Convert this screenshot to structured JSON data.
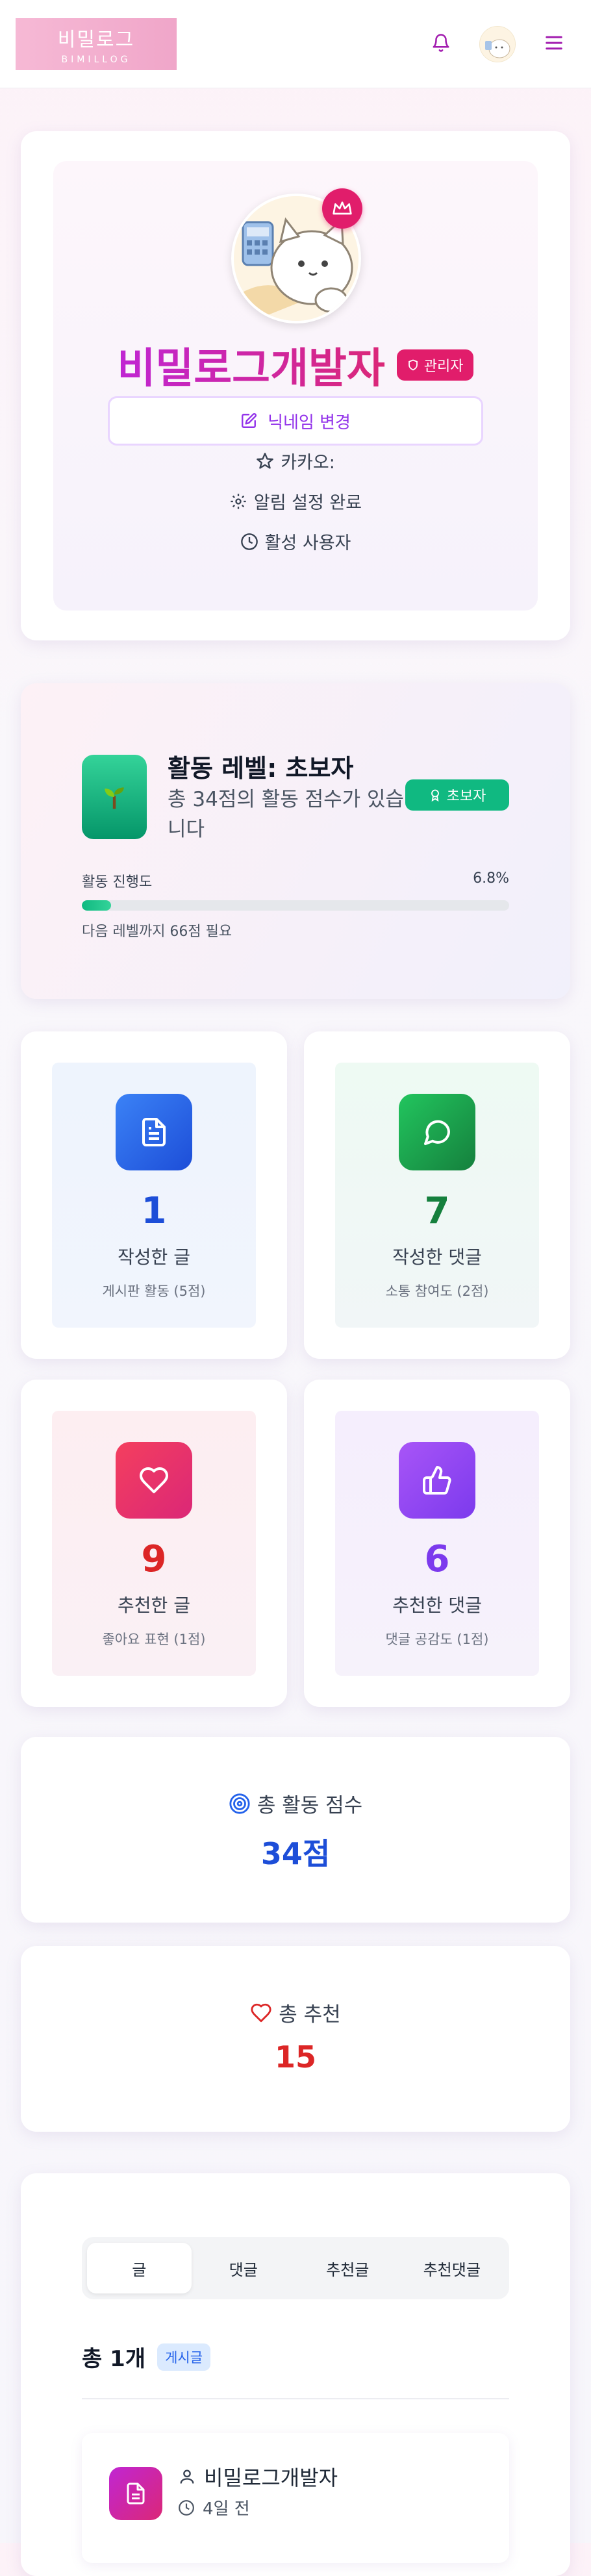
{
  "header": {
    "logo_title": "비밀로그",
    "logo_subtitle": "BIMILLOG",
    "icons": [
      "bell-icon",
      "avatar",
      "menu-icon"
    ]
  },
  "profile": {
    "name": "비밀로그개발자",
    "role_badge": "관리자",
    "nickname_button": "닉네임 변경",
    "kakao_label": "카카오:",
    "notification_status": "알림 설정 완료",
    "user_status": "활성 사용자"
  },
  "level": {
    "title": "활동 레벨: 초보자",
    "description": "총 34점의 활동 점수가 있습니다",
    "badge": "초보자",
    "progress_label": "활동 진행도",
    "progress_percent_text": "6.8%",
    "progress_value": 0.068,
    "next_level_note": "다음 레벨까지 66점 필요"
  },
  "stats": [
    {
      "value": "1",
      "label": "작성한 글",
      "sub": "게시판 활동 (5점)",
      "color": "#1d4ed8"
    },
    {
      "value": "7",
      "label": "작성한 댓글",
      "sub": "소통 참여도 (2점)",
      "color": "#15803d"
    },
    {
      "value": "9",
      "label": "추천한 글",
      "sub": "좋아요 표현 (1점)",
      "color": "#dc2626"
    },
    {
      "value": "6",
      "label": "추천한 댓글",
      "sub": "댓글 공감도 (1점)",
      "color": "#7c3aed"
    }
  ],
  "totals": {
    "score_title": "총 활동 점수",
    "score_value": "34점",
    "likes_title": "총 추천",
    "likes_value": "15"
  },
  "activity": {
    "tabs": [
      "글",
      "댓글",
      "추천글",
      "추천댓글"
    ],
    "active_tab": "글",
    "count_text": "총 1개",
    "count_badge": "게시글",
    "post": {
      "author": "비밀로그개발자",
      "time": "4일 전"
    }
  },
  "colors": {
    "brand_pink": "#db2777",
    "brand_purple": "#9333ea",
    "admin_red": "#e11d6b",
    "level_green": "#10b981"
  }
}
